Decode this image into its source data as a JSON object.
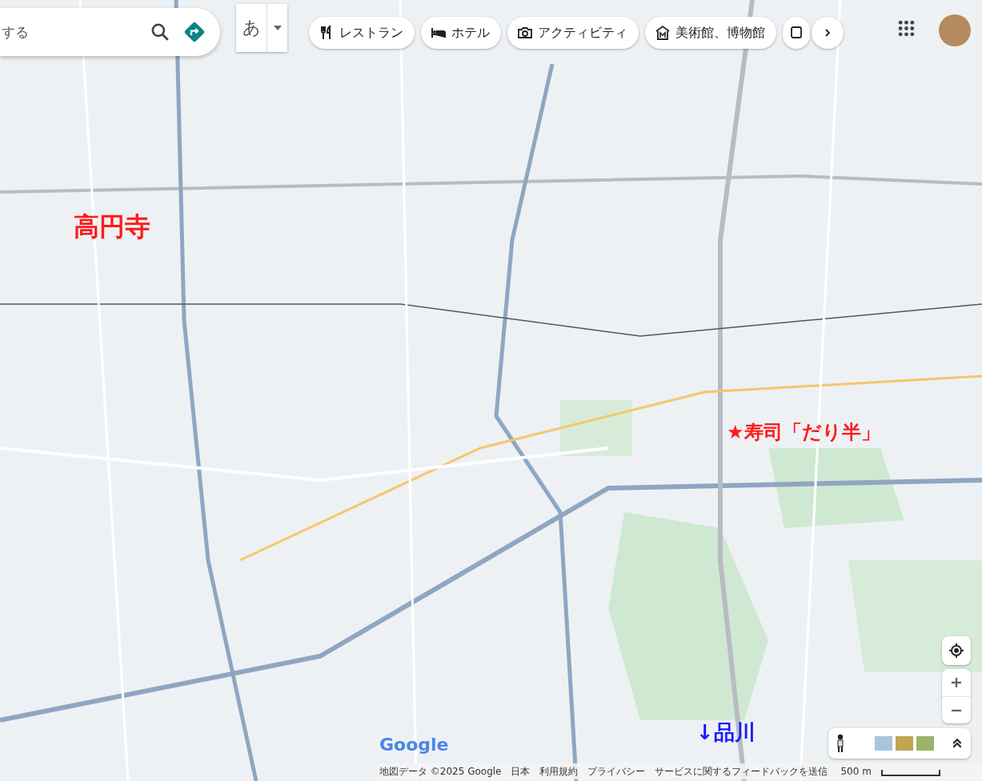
{
  "search": {
    "placeholder": "する"
  },
  "input_method": {
    "label": "あ"
  },
  "categories": [
    {
      "kind": "restaurant",
      "label": "レストラン"
    },
    {
      "kind": "hotel",
      "label": "ホテル"
    },
    {
      "kind": "activity",
      "label": "アクティビティ"
    },
    {
      "kind": "museum",
      "label": "美術館、博物館"
    },
    {
      "kind": "transit"
    }
  ],
  "annotations": [
    {
      "text": "高円寺",
      "color": "#ff1a1a"
    },
    {
      "text": "★寿司「だり半」",
      "color": "#ff1a1a"
    },
    {
      "text": "↓品川",
      "color": "#1a1aff"
    }
  ],
  "logo": "Google",
  "footer": {
    "links": [
      "地図データ ©2025 Google",
      "日本",
      "利用規約",
      "プライバシー",
      "サービスに関するフィードバックを送信"
    ],
    "scale": "500 m"
  }
}
